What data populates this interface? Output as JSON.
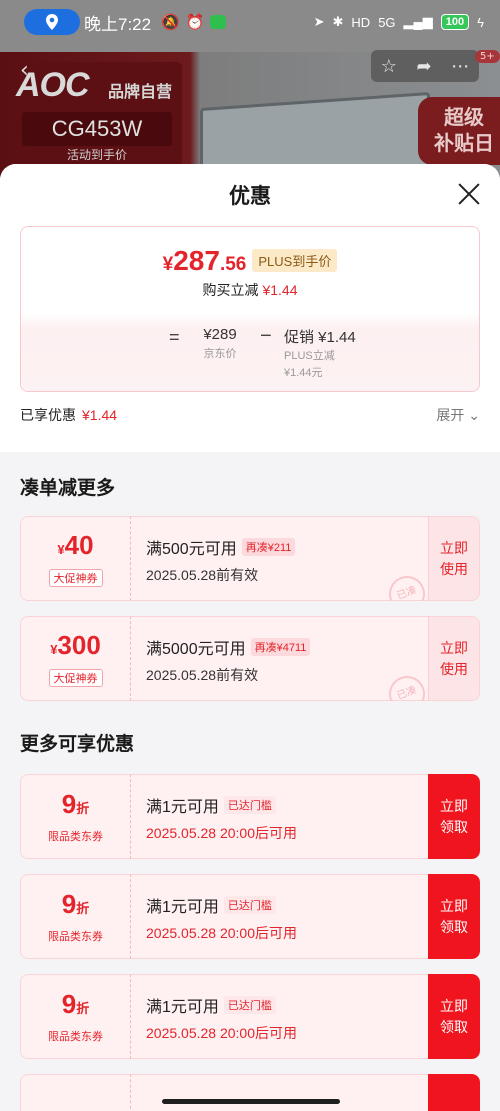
{
  "status_bar": {
    "time": "晚上7:22",
    "battery": "100",
    "network": "5G"
  },
  "background": {
    "brand_logo": "AOC",
    "brand_tag": "品牌自营",
    "model": "CG453W",
    "model_sub": "活动到手价",
    "badge_line1": "超级",
    "badge_line2": "补贴日",
    "notif_count": "5+"
  },
  "sheet": {
    "title": "优惠",
    "price_card": {
      "currency": "¥",
      "price_int": "287",
      "price_dec": ".56",
      "plus_tag": "PLUS到手价",
      "reduce_label": "购买立减",
      "reduce_value": "¥1.44",
      "equals": "=",
      "jd_price": "¥289",
      "jd_label": "京东价",
      "minus": "−",
      "promo_value": "促销 ¥1.44",
      "promo_label1": "PLUS立减",
      "promo_label2": "¥1.44元"
    },
    "enjoyed": {
      "label": "已享优惠",
      "value": "¥1.44",
      "expand": "展开"
    }
  },
  "section1": {
    "title": "凑单减更多",
    "coupons": [
      {
        "currency": "¥",
        "amount": "40",
        "type": "大促神券",
        "condition": "满500元可用",
        "chip": "再凑¥211",
        "date": "2025.05.28前有效",
        "stamp": "已凑",
        "button": "立即\n使用"
      },
      {
        "currency": "¥",
        "amount": "300",
        "type": "大促神券",
        "condition": "满5000元可用",
        "chip": "再凑¥4711",
        "date": "2025.05.28前有效",
        "stamp": "已凑",
        "button": "立即\n使用"
      }
    ]
  },
  "section2": {
    "title": "更多可享优惠",
    "coupons": [
      {
        "amount": "9",
        "unit": "折",
        "type": "限品类东券",
        "condition": "满1元可用",
        "chip": "已达门槛",
        "date": "2025.05.28 20:00后可用",
        "button": "立即\n领取"
      },
      {
        "amount": "9",
        "unit": "折",
        "type": "限品类东券",
        "condition": "满1元可用",
        "chip": "已达门槛",
        "date": "2025.05.28 20:00后可用",
        "button": "立即\n领取"
      },
      {
        "amount": "9",
        "unit": "折",
        "type": "限品类东券",
        "condition": "满1元可用",
        "chip": "已达门槛",
        "date": "2025.05.28 20:00后可用",
        "button": "立即\n领取"
      }
    ]
  },
  "colors": {
    "accent_red": "#e3242b",
    "button_red": "#f0141e",
    "coupon_bg": "#fff1f2"
  }
}
